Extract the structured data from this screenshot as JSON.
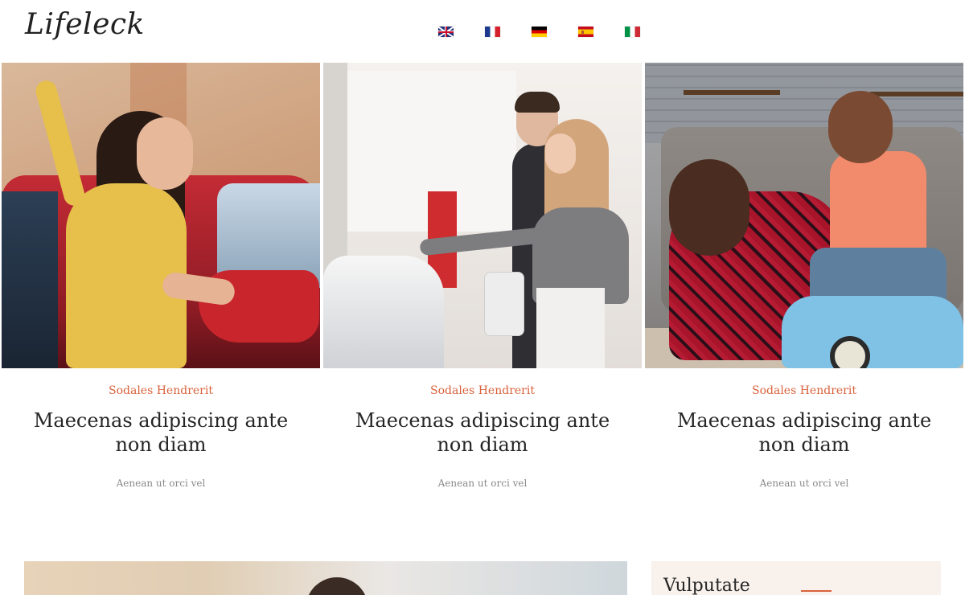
{
  "site": {
    "logo": "Lifeleck"
  },
  "languages": [
    {
      "code": "en",
      "icon": "uk-flag-icon"
    },
    {
      "code": "fr",
      "icon": "france-flag-icon"
    },
    {
      "code": "de",
      "icon": "germany-flag-icon"
    },
    {
      "code": "es",
      "icon": "spain-flag-icon"
    },
    {
      "code": "it",
      "icon": "italy-flag-icon"
    }
  ],
  "cards": [
    {
      "category": "Sodales Hendrerit",
      "title": "Maecenas adipiscing ante non diam",
      "excerpt": "Aenean ut orci vel"
    },
    {
      "category": "Sodales Hendrerit",
      "title": "Maecenas adipiscing ante non diam",
      "excerpt": "Aenean ut orci vel"
    },
    {
      "category": "Sodales Hendrerit",
      "title": "Maecenas adipiscing ante non diam",
      "excerpt": "Aenean ut orci vel"
    }
  ],
  "sidebar": {
    "title": "Vulputate"
  },
  "colors": {
    "accent": "#d9623b",
    "text": "#262626",
    "muted": "#8a8a8a",
    "sidebar_bg": "#f8f1ec"
  }
}
